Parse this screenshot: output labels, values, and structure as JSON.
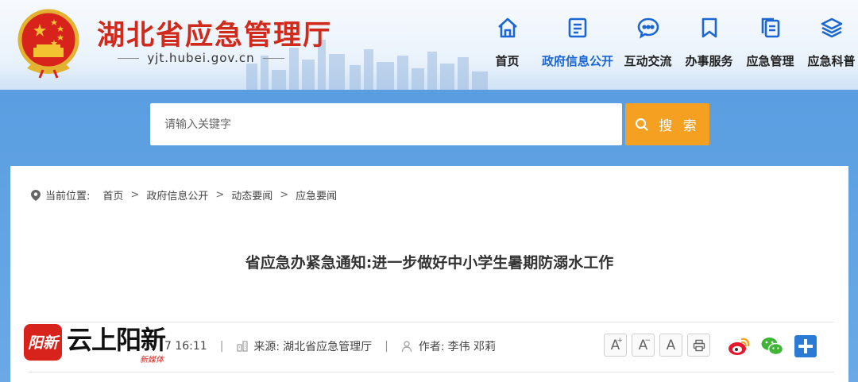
{
  "header": {
    "site_title": "湖北省应急管理厅",
    "domain": "yjt.hubei.gov.cn"
  },
  "nav": [
    {
      "label": "首页",
      "icon": "home-icon",
      "active": false
    },
    {
      "label": "政府信息公开",
      "icon": "document-icon",
      "active": true
    },
    {
      "label": "互动交流",
      "icon": "chat-icon",
      "active": false
    },
    {
      "label": "办事服务",
      "icon": "bookmark-icon",
      "active": false
    },
    {
      "label": "应急管理",
      "icon": "files-icon",
      "active": false
    },
    {
      "label": "应急科普",
      "icon": "layers-icon",
      "active": false
    }
  ],
  "search": {
    "placeholder": "请输入关键字",
    "button_label": "搜 索"
  },
  "breadcrumb": {
    "prefix": "当前位置:",
    "items": [
      "首页",
      "政府信息公开",
      "动态要闻",
      "应急要闻"
    ]
  },
  "article": {
    "title": "省应急办紧急通知:进一步做好中小学生暑期防溺水工作",
    "publish_time_partial": "7 16:11",
    "source_label": "来源:",
    "source": "湖北省应急管理厅",
    "author_label": "作者:",
    "author": "李伟 邓莉"
  },
  "tools": {
    "font_increase": "A",
    "font_decrease": "A",
    "font_reset": "A"
  },
  "watermark": {
    "logo_text": "阳新",
    "text": "云上阳新",
    "sub": "新媒体"
  },
  "colors": {
    "title_red": "#d02a1c",
    "active_blue": "#1b66d2",
    "search_orange": "#f6a021",
    "band_blue": "#5a9ee1"
  }
}
